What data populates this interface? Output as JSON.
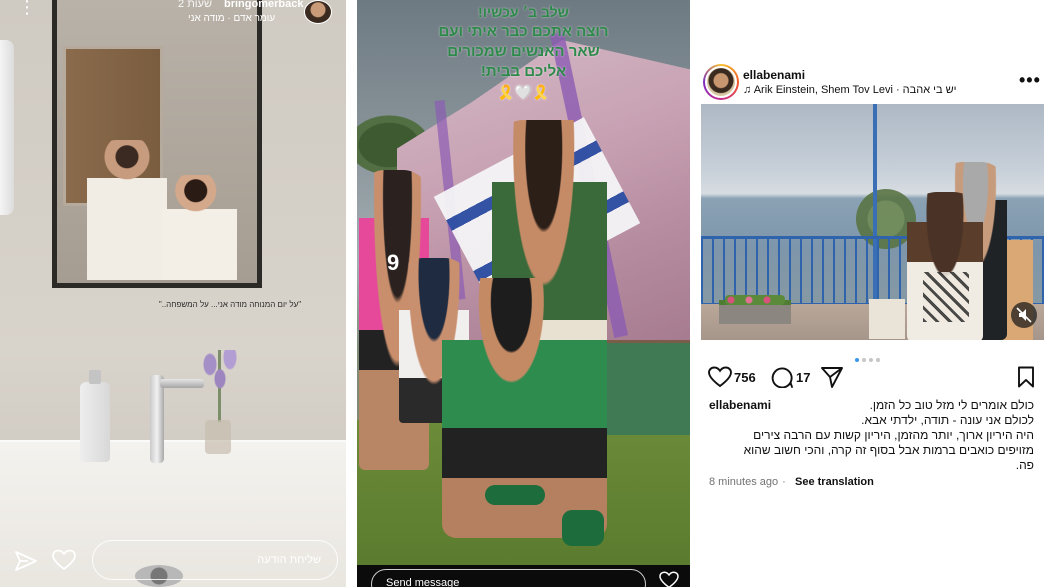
{
  "story_left": {
    "username": "bringomerback",
    "time": "2 שעות",
    "music": "עומר אדם · מודה אני",
    "caption": "\"על יום המנוחה מודה אני... על המשפחה..\"",
    "reply_placeholder": "שליחת הודעה"
  },
  "story_middle": {
    "text_lines": [
      "שלב ב׳ עכשיו!",
      "רוצה אתכם כבר איתי ועם",
      "שאר האנשים שמכורים",
      "אליכם בבית!"
    ],
    "emoji_line": "🎗️🤍🎗️",
    "jersey_number": "9",
    "reply_placeholder": "Send message"
  },
  "post": {
    "username": "ellabenami",
    "music": "Arik Einstein, Shem Tov Levi · יש בי אהבה",
    "likes": "756",
    "comments": "17",
    "caption_user": "ellabenami",
    "caption_lines": [
      "כולם אומרים לי מזל טוב כל הזמן.",
      "לכולם אני עונה - תודה, ילדתי אבא.",
      "היה היריון ארוך, יותר מהזמן, היריון קשות עם הרבה צירים",
      "מזויפים כואבים ברמות אבל בסוף זה קרה, והכי חשוב שהוא",
      "פה."
    ],
    "time_ago": "8 minutes ago",
    "translate_label": "See translation",
    "carousel_count": 4,
    "carousel_active": 0,
    "accent_color": "#3897f0"
  },
  "icons": {
    "send": "send-icon",
    "heart": "heart-icon",
    "comment": "comment-icon",
    "save": "bookmark-icon",
    "more": "more-icon",
    "music": "music-note-icon",
    "mute": "mute-icon"
  }
}
